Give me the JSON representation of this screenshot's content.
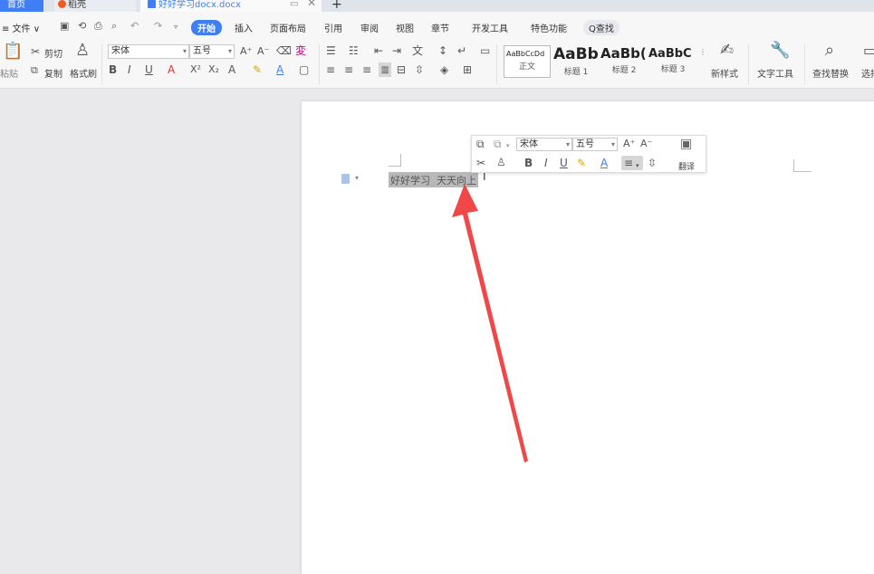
{
  "tabs": {
    "home": "首页",
    "daoke": "稻壳",
    "doc": "好好学习docx.docx",
    "add": "+"
  },
  "menu": {
    "file": "≡ 文件 ∨",
    "start": "开始",
    "items": [
      "插入",
      "页面布局",
      "引用",
      "审阅",
      "视图",
      "章节",
      "开发工具",
      "特色功能"
    ],
    "search": "Q查找"
  },
  "ribbon": {
    "paste": "粘贴",
    "cut": "剪切",
    "copy": "复制",
    "format_painter": "格式刷",
    "font_name": "宋体",
    "font_size": "五号",
    "styles": [
      {
        "preview": "AaBbCcDd",
        "label": "正文"
      },
      {
        "preview": "AaBb",
        "label": "标题 1"
      },
      {
        "preview": "AaBb(",
        "label": "标题 2"
      },
      {
        "preview": "AaBbC",
        "label": "标题 3"
      }
    ],
    "new_style": "新样式",
    "text_tools": "文字工具",
    "find_replace": "查找替换",
    "select": "选择"
  },
  "mini_toolbar": {
    "font_name": "宋体",
    "font_size": "五号",
    "translate": "翻译"
  },
  "document": {
    "text": "好好学习  天天向上"
  },
  "colors": {
    "accent": "#3f7ff5",
    "arrow": "#f04848",
    "selection": "#b8b8b8"
  }
}
